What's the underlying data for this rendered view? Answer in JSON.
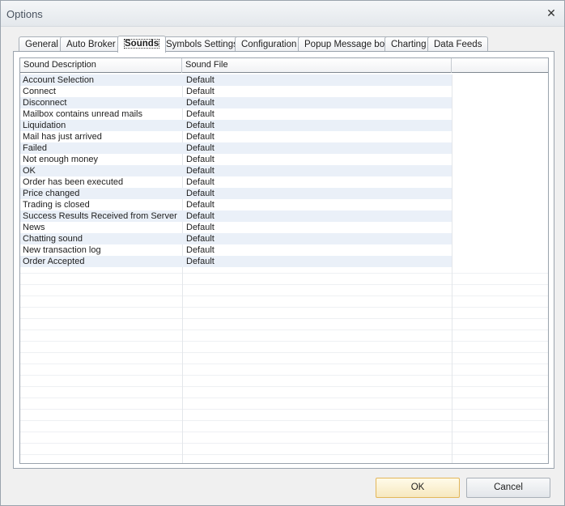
{
  "window": {
    "title": "Options",
    "close_glyph": "✕"
  },
  "tabs": [
    {
      "label": "General"
    },
    {
      "label": "Auto Broker"
    },
    {
      "label": "Sounds",
      "active": true
    },
    {
      "label": "Symbols Settings"
    },
    {
      "label": "Configuration"
    },
    {
      "label": "Popup Message box"
    },
    {
      "label": "Charting"
    },
    {
      "label": "Data Feeds"
    }
  ],
  "grid": {
    "columns": [
      "Sound Description",
      "Sound File"
    ],
    "rows": [
      [
        "Account Selection",
        "Default"
      ],
      [
        "Connect",
        "Default"
      ],
      [
        "Disconnect",
        "Default"
      ],
      [
        "Mailbox contains unread mails",
        "Default"
      ],
      [
        "Liquidation",
        "Default"
      ],
      [
        "Mail has just arrived",
        "Default"
      ],
      [
        "Failed",
        "Default"
      ],
      [
        "Not enough money",
        "Default"
      ],
      [
        "OK",
        "Default"
      ],
      [
        "Order has been executed",
        "Default"
      ],
      [
        "Price changed",
        "Default"
      ],
      [
        "Trading is closed",
        "Default"
      ],
      [
        "Success Results Received from Server",
        "Default"
      ],
      [
        "News",
        "Default"
      ],
      [
        "Chatting sound",
        "Default"
      ],
      [
        "New transaction log",
        "Default"
      ],
      [
        "Order Accepted",
        "Default"
      ]
    ]
  },
  "buttons": {
    "ok_label": "OK",
    "cancel_label": "Cancel"
  }
}
